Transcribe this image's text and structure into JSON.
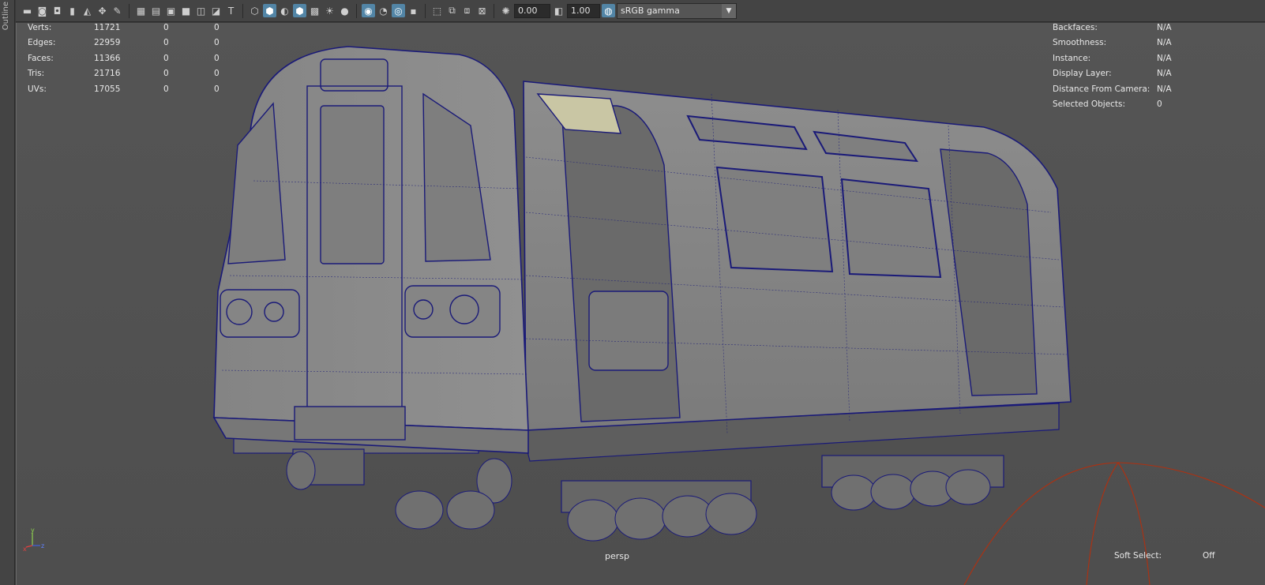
{
  "sidebar": {
    "label": "Outline"
  },
  "toolbar": {
    "icons": [
      "camera-icon",
      "camera-attr-icon",
      "bookmark-icon",
      "image-plane-icon",
      "grid-icon",
      "film-gate-icon",
      "resolution-gate-icon",
      "gate-mask-icon",
      "field-chart-icon",
      "safe-action-icon",
      "safe-title-icon",
      "wireframe-icon",
      "smooth-shade-icon",
      "default-material-icon",
      "textured-icon",
      "lights-icon",
      "shadows-icon",
      "ambient-occlusion-icon",
      "xray-icon",
      "isolate-select-icon",
      "exposure-icon",
      "gamma-icon",
      "color-mgmt-icon"
    ],
    "exposure_value": "0.00",
    "gamma_value": "1.00",
    "color_space": "sRGB gamma"
  },
  "hud_stats": [
    {
      "label": "Verts:",
      "v1": "11721",
      "v2": "0",
      "v3": "0"
    },
    {
      "label": "Edges:",
      "v1": "22959",
      "v2": "0",
      "v3": "0"
    },
    {
      "label": "Faces:",
      "v1": "11366",
      "v2": "0",
      "v3": "0"
    },
    {
      "label": "Tris:",
      "v1": "21716",
      "v2": "0",
      "v3": "0"
    },
    {
      "label": "UVs:",
      "v1": "17055",
      "v2": "0",
      "v3": "0"
    }
  ],
  "hud_info": [
    {
      "label": "Backfaces:",
      "value": "N/A"
    },
    {
      "label": "Smoothness:",
      "value": "N/A"
    },
    {
      "label": "Instance:",
      "value": "N/A"
    },
    {
      "label": "Display Layer:",
      "value": "N/A"
    },
    {
      "label": "Distance From Camera:",
      "value": "N/A"
    },
    {
      "label": "Selected Objects:",
      "value": "0"
    }
  ],
  "viewport": {
    "camera": "persp",
    "soft_select_label": "Soft Select:",
    "soft_select_value": "Off"
  },
  "axis": {
    "y": "y",
    "x": "x",
    "z": "z"
  },
  "colors": {
    "wire": "#1a1a78",
    "mesh": "#8a8a8a",
    "accent": "#5285a6",
    "light_gizmo": "#b03010"
  }
}
